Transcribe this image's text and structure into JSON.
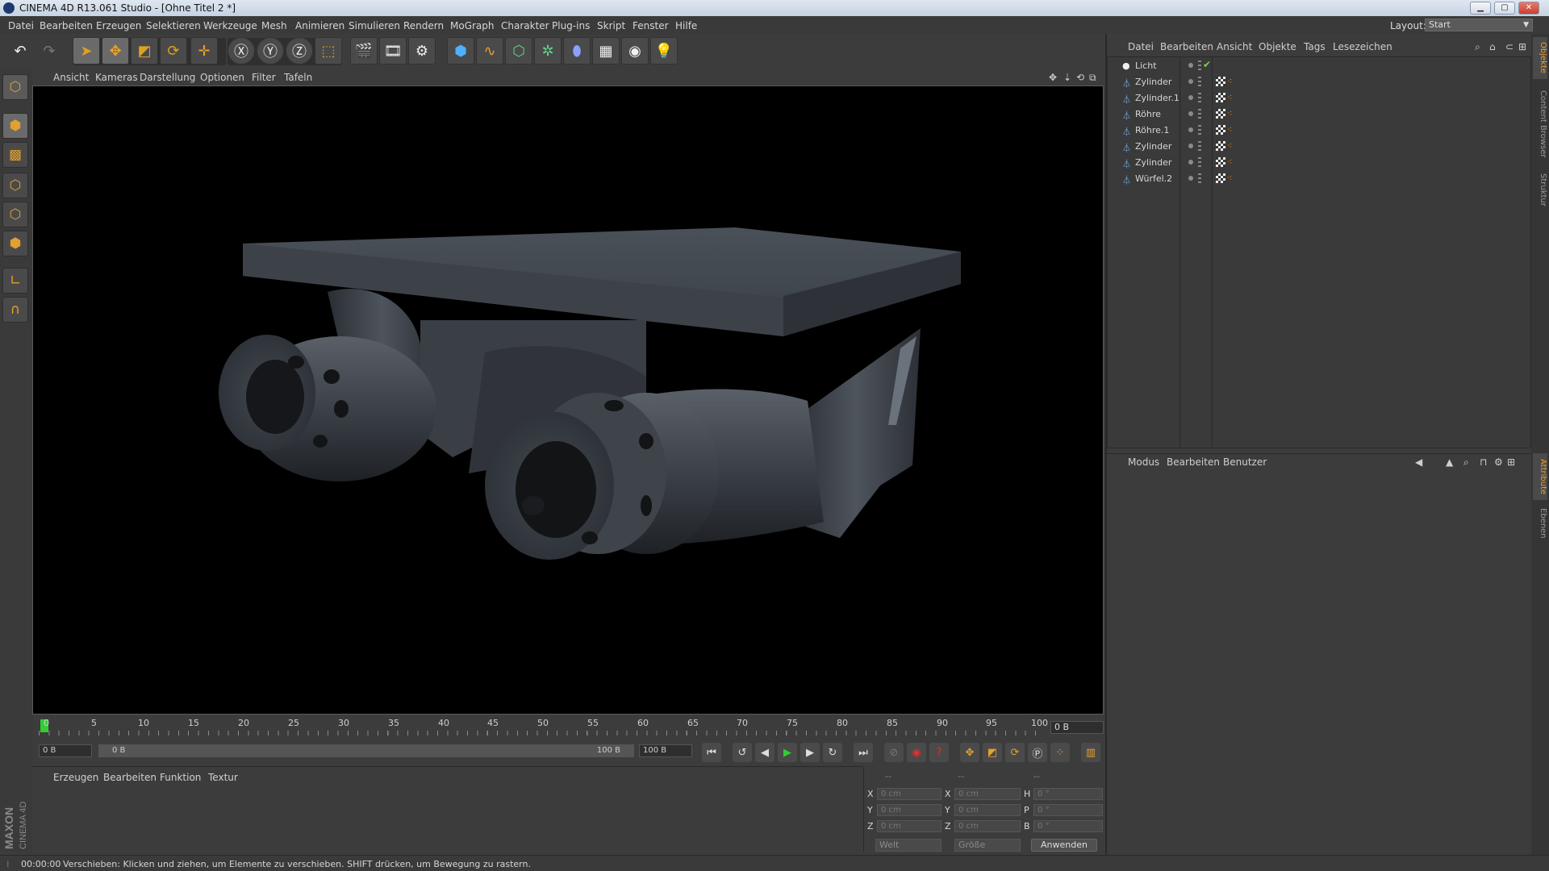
{
  "window": {
    "title": "CINEMA 4D R13.061 Studio - [Ohne Titel 2 *]",
    "minimize": "▁",
    "restore": "▢",
    "close": "✕"
  },
  "menubar": {
    "items": [
      "Datei",
      "Bearbeiten",
      "Erzeugen",
      "Selektieren",
      "Werkzeuge",
      "Mesh",
      "Animieren",
      "Simulieren",
      "Rendern",
      "MoGraph",
      "Charakter",
      "Plug-ins",
      "Skript",
      "Fenster",
      "Hilfe"
    ],
    "layout_label": "Layout:",
    "layout_value": "Start"
  },
  "viewport": {
    "menu": [
      "Ansicht",
      "Kameras",
      "Darstellung",
      "Optionen",
      "Filter",
      "Tafeln"
    ],
    "icons": [
      "move-view-icon",
      "pan-view-icon",
      "rotate-view-icon",
      "maximize-view-icon"
    ]
  },
  "timeline": {
    "ticks": [
      "0",
      "5",
      "10",
      "15",
      "20",
      "25",
      "30",
      "35",
      "40",
      "45",
      "50",
      "55",
      "60",
      "65",
      "70",
      "75",
      "80",
      "85",
      "90",
      "95",
      "100"
    ],
    "current_frame": "0 B",
    "start_field": "0 B",
    "range_start": "0 B",
    "range_end": "100 B",
    "end_field": "100 B"
  },
  "material_manager": {
    "menu": [
      "Erzeugen",
      "Bearbeiten",
      "Funktion",
      "Textur"
    ]
  },
  "coordinates": {
    "headers": [
      "--",
      "--",
      "--"
    ],
    "pos_labels": [
      "X",
      "Y",
      "Z"
    ],
    "size_labels": [
      "X",
      "Y",
      "Z"
    ],
    "rot_labels": [
      "H",
      "P",
      "B"
    ],
    "pos_values": [
      "0 cm",
      "0 cm",
      "0 cm"
    ],
    "size_values": [
      "0 cm",
      "0 cm",
      "0 cm"
    ],
    "rot_values": [
      "0 °",
      "0 °",
      "0 °"
    ],
    "mode_world": "Welt",
    "mode_size": "Größe",
    "apply": "Anwenden"
  },
  "object_manager": {
    "menu": [
      "Datei",
      "Bearbeiten",
      "Ansicht",
      "Objekte",
      "Tags",
      "Lesezeichen"
    ],
    "objects": [
      {
        "name": "Licht",
        "icon": "light-icon"
      },
      {
        "name": "Zylinder",
        "icon": "cylinder-icon"
      },
      {
        "name": "Zylinder.1",
        "icon": "cylinder-icon"
      },
      {
        "name": "Röhre",
        "icon": "tube-icon"
      },
      {
        "name": "Röhre.1",
        "icon": "tube-icon"
      },
      {
        "name": "Zylinder",
        "icon": "cylinder-icon"
      },
      {
        "name": "Zylinder",
        "icon": "cylinder-icon"
      },
      {
        "name": "Würfel.2",
        "icon": "cube-icon"
      }
    ]
  },
  "attribute_manager": {
    "menu": [
      "Modus",
      "Bearbeiten",
      "Benutzer"
    ]
  },
  "side_tabs": {
    "top": [
      "Objekte",
      "Content Browser",
      "Struktur"
    ],
    "bottom": [
      "Attribute",
      "Ebenen"
    ]
  },
  "status": {
    "time": "00:00:00",
    "message": "Verschieben: Klicken und ziehen, um Elemente zu verschieben. SHIFT drücken, um Bewegung zu rastern."
  },
  "branding": {
    "maxon": "MAXON",
    "product": "CINEMA 4D"
  },
  "colors": {
    "accent_orange": "#e8a030",
    "play_green": "#33cc33",
    "record_red": "#e03030",
    "viewport_bg": "#000000",
    "ui_bg": "#3c3c3c"
  }
}
